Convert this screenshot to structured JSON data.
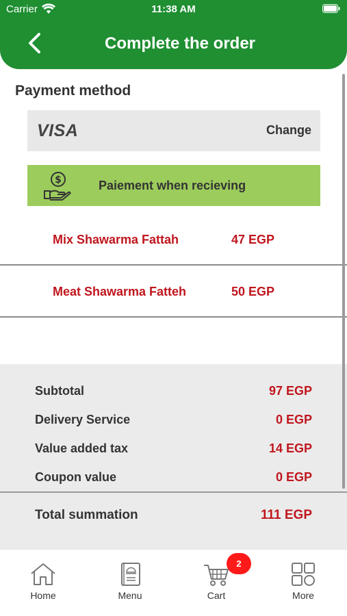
{
  "status_bar": {
    "carrier": "Carrier",
    "time": "11:38 AM"
  },
  "header": {
    "title": "Complete the order"
  },
  "payment": {
    "section_title": "Payment method",
    "card_brand": "VISA",
    "change_label": "Change",
    "cash_option_label": "Paiement when recieving"
  },
  "items": [
    {
      "name": "Mix Shawarma Fattah",
      "price": "47 EGP"
    },
    {
      "name": "Meat Shawarma Fatteh",
      "price": "50 EGP"
    }
  ],
  "summary": {
    "subtotal_label": "Subtotal",
    "subtotal_value": "97 EGP",
    "delivery_label": "Delivery Service",
    "delivery_value": "0 EGP",
    "vat_label": "Value added tax",
    "vat_value": "14 EGP",
    "coupon_label": "Coupon value",
    "coupon_value": "0 EGP",
    "total_label": "Total summation",
    "total_value": "111 EGP"
  },
  "tabbar": {
    "home_label": "Home",
    "menu_label": "Menu",
    "cart_label": "Cart",
    "more_label": "More",
    "cart_badge": "2"
  },
  "colors": {
    "header_green": "#1f8f32",
    "cash_option_green": "#9ccc5c",
    "price_red": "#c0161e",
    "badge_red": "#ff1a1a"
  }
}
